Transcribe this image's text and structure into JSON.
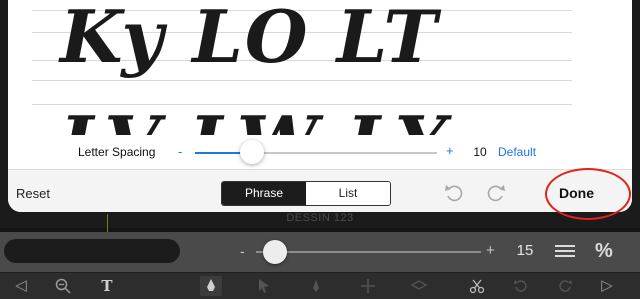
{
  "preview": {
    "line1": "Ky LO LT",
    "line2": "LV LW LY"
  },
  "letter_spacing": {
    "label": "Letter Spacing",
    "minus": "-",
    "plus": "+",
    "value": "10",
    "slider_fraction": 0.25,
    "default_label": "Default"
  },
  "sheet_toolbar": {
    "reset_label": "Reset",
    "segments": [
      "Phrase",
      "List"
    ],
    "selected_segment": "Phrase",
    "undo_icon": "undo-icon",
    "redo_icon": "redo-icon",
    "done_label": "Done"
  },
  "background": {
    "doc_label": "DESSIN 123"
  },
  "bottom_toolbar": {
    "minus": "-",
    "plus": "+",
    "value": "15",
    "slider_fraction": 0.06,
    "menu_icon": "menu-icon",
    "percent_icon": "%"
  },
  "tools": {
    "prev_icon": "◁",
    "zoom_icon": "zoom-out-icon",
    "text_icon": "T",
    "next_icon": "▷"
  },
  "colors": {
    "accent": "#1e78e0",
    "annotation": "#e0231c"
  }
}
